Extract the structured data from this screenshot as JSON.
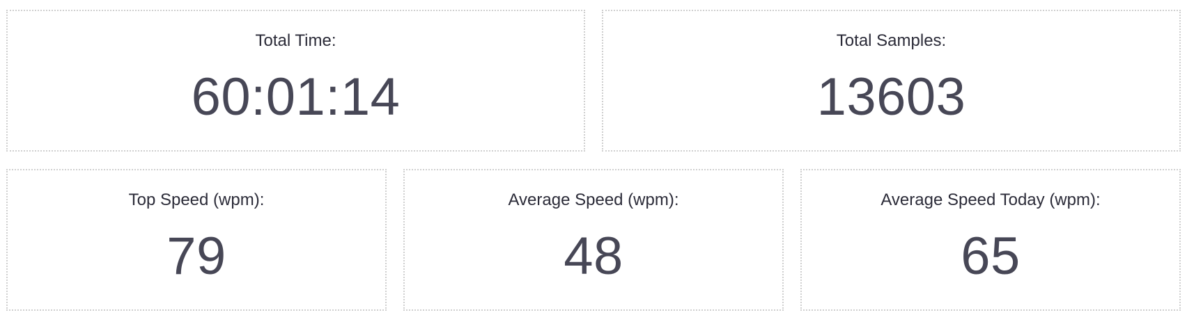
{
  "stats": {
    "total_time": {
      "label": "Total Time:",
      "value": "60:01:14"
    },
    "total_samples": {
      "label": "Total Samples:",
      "value": "13603"
    },
    "top_speed": {
      "label": "Top Speed (wpm):",
      "value": "79"
    },
    "average_speed": {
      "label": "Average Speed (wpm):",
      "value": "48"
    },
    "average_speed_today": {
      "label": "Average Speed Today (wpm):",
      "value": "65"
    }
  },
  "colors": {
    "border": "#cfcfcf",
    "label_text": "#2b2b38",
    "value_text": "#474756",
    "background": "#ffffff"
  }
}
